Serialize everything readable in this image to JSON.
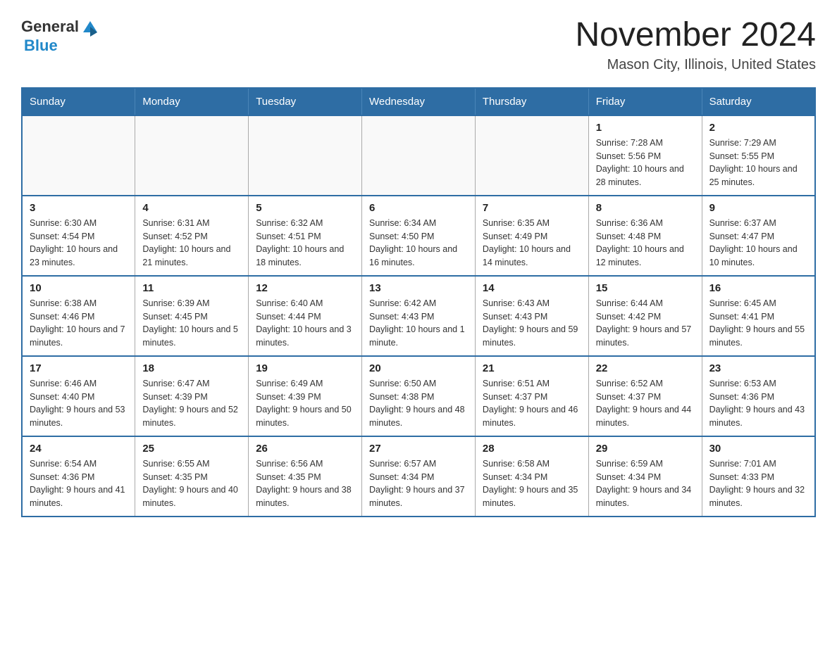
{
  "logo": {
    "general": "General",
    "blue": "Blue"
  },
  "title": "November 2024",
  "subtitle": "Mason City, Illinois, United States",
  "days_of_week": [
    "Sunday",
    "Monday",
    "Tuesday",
    "Wednesday",
    "Thursday",
    "Friday",
    "Saturday"
  ],
  "weeks": [
    [
      {
        "day": "",
        "info": ""
      },
      {
        "day": "",
        "info": ""
      },
      {
        "day": "",
        "info": ""
      },
      {
        "day": "",
        "info": ""
      },
      {
        "day": "",
        "info": ""
      },
      {
        "day": "1",
        "info": "Sunrise: 7:28 AM\nSunset: 5:56 PM\nDaylight: 10 hours and 28 minutes."
      },
      {
        "day": "2",
        "info": "Sunrise: 7:29 AM\nSunset: 5:55 PM\nDaylight: 10 hours and 25 minutes."
      }
    ],
    [
      {
        "day": "3",
        "info": "Sunrise: 6:30 AM\nSunset: 4:54 PM\nDaylight: 10 hours and 23 minutes."
      },
      {
        "day": "4",
        "info": "Sunrise: 6:31 AM\nSunset: 4:52 PM\nDaylight: 10 hours and 21 minutes."
      },
      {
        "day": "5",
        "info": "Sunrise: 6:32 AM\nSunset: 4:51 PM\nDaylight: 10 hours and 18 minutes."
      },
      {
        "day": "6",
        "info": "Sunrise: 6:34 AM\nSunset: 4:50 PM\nDaylight: 10 hours and 16 minutes."
      },
      {
        "day": "7",
        "info": "Sunrise: 6:35 AM\nSunset: 4:49 PM\nDaylight: 10 hours and 14 minutes."
      },
      {
        "day": "8",
        "info": "Sunrise: 6:36 AM\nSunset: 4:48 PM\nDaylight: 10 hours and 12 minutes."
      },
      {
        "day": "9",
        "info": "Sunrise: 6:37 AM\nSunset: 4:47 PM\nDaylight: 10 hours and 10 minutes."
      }
    ],
    [
      {
        "day": "10",
        "info": "Sunrise: 6:38 AM\nSunset: 4:46 PM\nDaylight: 10 hours and 7 minutes."
      },
      {
        "day": "11",
        "info": "Sunrise: 6:39 AM\nSunset: 4:45 PM\nDaylight: 10 hours and 5 minutes."
      },
      {
        "day": "12",
        "info": "Sunrise: 6:40 AM\nSunset: 4:44 PM\nDaylight: 10 hours and 3 minutes."
      },
      {
        "day": "13",
        "info": "Sunrise: 6:42 AM\nSunset: 4:43 PM\nDaylight: 10 hours and 1 minute."
      },
      {
        "day": "14",
        "info": "Sunrise: 6:43 AM\nSunset: 4:43 PM\nDaylight: 9 hours and 59 minutes."
      },
      {
        "day": "15",
        "info": "Sunrise: 6:44 AM\nSunset: 4:42 PM\nDaylight: 9 hours and 57 minutes."
      },
      {
        "day": "16",
        "info": "Sunrise: 6:45 AM\nSunset: 4:41 PM\nDaylight: 9 hours and 55 minutes."
      }
    ],
    [
      {
        "day": "17",
        "info": "Sunrise: 6:46 AM\nSunset: 4:40 PM\nDaylight: 9 hours and 53 minutes."
      },
      {
        "day": "18",
        "info": "Sunrise: 6:47 AM\nSunset: 4:39 PM\nDaylight: 9 hours and 52 minutes."
      },
      {
        "day": "19",
        "info": "Sunrise: 6:49 AM\nSunset: 4:39 PM\nDaylight: 9 hours and 50 minutes."
      },
      {
        "day": "20",
        "info": "Sunrise: 6:50 AM\nSunset: 4:38 PM\nDaylight: 9 hours and 48 minutes."
      },
      {
        "day": "21",
        "info": "Sunrise: 6:51 AM\nSunset: 4:37 PM\nDaylight: 9 hours and 46 minutes."
      },
      {
        "day": "22",
        "info": "Sunrise: 6:52 AM\nSunset: 4:37 PM\nDaylight: 9 hours and 44 minutes."
      },
      {
        "day": "23",
        "info": "Sunrise: 6:53 AM\nSunset: 4:36 PM\nDaylight: 9 hours and 43 minutes."
      }
    ],
    [
      {
        "day": "24",
        "info": "Sunrise: 6:54 AM\nSunset: 4:36 PM\nDaylight: 9 hours and 41 minutes."
      },
      {
        "day": "25",
        "info": "Sunrise: 6:55 AM\nSunset: 4:35 PM\nDaylight: 9 hours and 40 minutes."
      },
      {
        "day": "26",
        "info": "Sunrise: 6:56 AM\nSunset: 4:35 PM\nDaylight: 9 hours and 38 minutes."
      },
      {
        "day": "27",
        "info": "Sunrise: 6:57 AM\nSunset: 4:34 PM\nDaylight: 9 hours and 37 minutes."
      },
      {
        "day": "28",
        "info": "Sunrise: 6:58 AM\nSunset: 4:34 PM\nDaylight: 9 hours and 35 minutes."
      },
      {
        "day": "29",
        "info": "Sunrise: 6:59 AM\nSunset: 4:34 PM\nDaylight: 9 hours and 34 minutes."
      },
      {
        "day": "30",
        "info": "Sunrise: 7:01 AM\nSunset: 4:33 PM\nDaylight: 9 hours and 32 minutes."
      }
    ]
  ]
}
